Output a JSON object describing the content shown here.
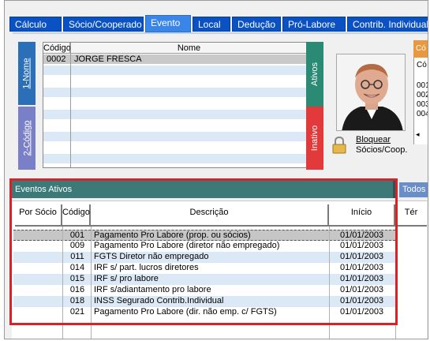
{
  "tabs": [
    {
      "label": "Cálculo",
      "active": false
    },
    {
      "label": "Sócio/Cooperado",
      "active": false
    },
    {
      "label": "Evento",
      "active": true
    },
    {
      "label": "Local",
      "active": false
    },
    {
      "label": "Dedução",
      "active": false
    },
    {
      "label": "Pró-Labore",
      "active": false
    },
    {
      "label": "Contrib. Individual",
      "active": false
    }
  ],
  "side_tabs": {
    "nome": "1-Nome",
    "codigo": "2-Código",
    "ativos": "Ativos",
    "inativo": "Inativo"
  },
  "socio_grid": {
    "columns": [
      "Código",
      "Nome"
    ],
    "rows": [
      {
        "codigo": "0002",
        "nome": "JORGE FRESCA"
      }
    ]
  },
  "lock": {
    "line1": "Bloquear",
    "line2": "Sócios/Coop."
  },
  "right_partial": {
    "tab": "Có",
    "label": "Có",
    "items": [
      "001",
      "002",
      "003",
      "004"
    ]
  },
  "eventos": {
    "header": "Eventos Ativos",
    "todos_tab": "Todos",
    "columns": [
      "Por Sócio",
      "Código",
      "Descrição",
      "Início",
      "Tér"
    ],
    "rows": [
      {
        "codigo": "001",
        "descricao": "Pagamento Pro Labore (prop. ou sócios)",
        "inicio": "01/01/2003"
      },
      {
        "codigo": "009",
        "descricao": "Pagamento Pro Labore (diretor não empregado)",
        "inicio": "01/01/2003"
      },
      {
        "codigo": "011",
        "descricao": "FGTS Diretor não empregado",
        "inicio": "01/01/2003"
      },
      {
        "codigo": "014",
        "descricao": "IRF s/ part. lucros diretores",
        "inicio": "01/01/2003"
      },
      {
        "codigo": "015",
        "descricao": "IRF s/ pro labore",
        "inicio": "01/01/2003"
      },
      {
        "codigo": "016",
        "descricao": "IRF s/adiantamento pro labore",
        "inicio": "01/01/2003"
      },
      {
        "codigo": "018",
        "descricao": "INSS Segurado Contrib.Individual",
        "inicio": "01/01/2003"
      },
      {
        "codigo": "021",
        "descricao": "Pagamento Pro Labore (dir. não emp. c/ FGTS)",
        "inicio": "01/01/2003"
      }
    ]
  },
  "colors": {
    "tab": "#0a52c4",
    "tab_active": "#3a86e8",
    "nome_tab": "#2a6fb8",
    "codigo_tab": "#7a80c8",
    "ativos_tab": "#2a8a74",
    "inativo_tab": "#e23a3a",
    "eventos_header": "#3c7a7a",
    "highlight": "#d6232a",
    "row_alt": "#dbe8f5"
  }
}
